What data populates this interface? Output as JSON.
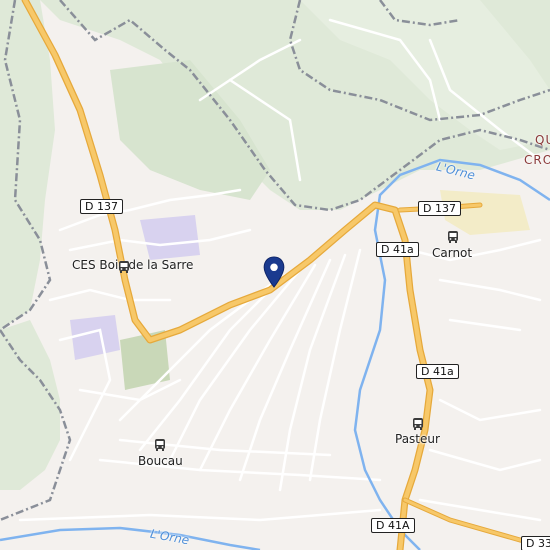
{
  "map": {
    "colors": {
      "forest": "#dfe9d8",
      "urban": "#ece7e3",
      "road_major": "#f7c869",
      "road_major_edge": "#e6a93b",
      "street": "#ffffff",
      "water": "#7fb3ef",
      "boundary": "#8a8f99",
      "marker": "#1a3a8f",
      "school": "#d8d2ef",
      "sport": "#c9d8b8",
      "industrial": "#f3ecc8"
    },
    "road_labels": [
      {
        "id": "d137-west",
        "text": "D 137"
      },
      {
        "id": "d137-east",
        "text": "D 137"
      },
      {
        "id": "d41a-north",
        "text": "D 41a"
      },
      {
        "id": "d41a-middle",
        "text": "D 41a"
      },
      {
        "id": "d41A-south",
        "text": "D 41A"
      },
      {
        "id": "d33-edge",
        "text": "D 33"
      }
    ],
    "stops": [
      {
        "id": "ces-bois-de-la-sarre",
        "name": "CES Bois de la Sarre",
        "icon": "bus-stop-icon"
      },
      {
        "id": "carnot",
        "name": "Carnot",
        "icon": "bus-stop-icon"
      },
      {
        "id": "pasteur",
        "name": "Pasteur",
        "icon": "bus-stop-icon"
      },
      {
        "id": "boucau",
        "name": "Boucau",
        "icon": "bus-stop-icon"
      }
    ],
    "rivers": [
      {
        "id": "orne-north",
        "text": "L'Orne"
      },
      {
        "id": "orne-south",
        "text": "L'Orne"
      }
    ],
    "district": {
      "line1": "QU",
      "line2": "CRO"
    },
    "marker": {
      "icon": "location-pin-icon"
    }
  }
}
